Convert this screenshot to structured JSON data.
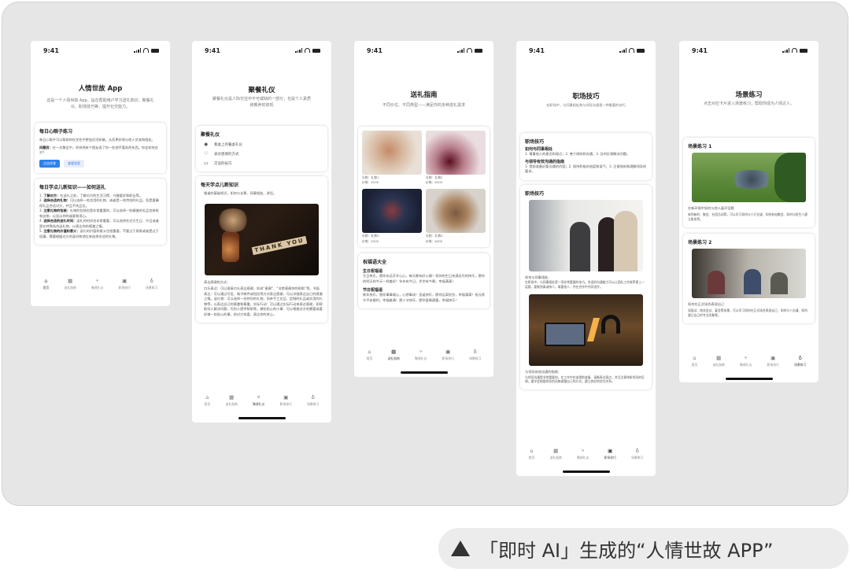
{
  "status_time": "9:41",
  "tabs": [
    {
      "label": "首页",
      "icon": "home-icon",
      "glyph": "⌂"
    },
    {
      "label": "送礼指南",
      "icon": "gift-icon",
      "glyph": "▦"
    },
    {
      "label": "聚餐礼仪",
      "icon": "utensils-icon",
      "glyph": "⑂"
    },
    {
      "label": "职场技巧",
      "icon": "briefcase-icon",
      "glyph": "▣"
    },
    {
      "label": "场景练习",
      "icon": "bulb-icon",
      "glyph": "♁"
    }
  ],
  "screen1": {
    "title": "人情世故 App",
    "subtitle": "这是一个人情世故 App，旨在帮助用户学习送礼知识、聚餐礼仪、职场技巧等，提升社交能力。",
    "card1": {
      "title": "每日心眼子练习",
      "intro": "每日心眼子可以帮助你在交往中更加灵活机敏。从而更好地与他人交流和相处。",
      "question_label": "问题目：",
      "question": "在一次聚会中，你突然有个朋友说了你一些他不喜欢的东西。你会如何应对?",
      "btn_primary": "点击作答",
      "btn_secondary": "查看答案"
    },
    "card2": {
      "title": "每日学点儿新知识——如何送礼",
      "items": [
        {
          "label": "了解对方：",
          "text": "在送礼之前，了解对方的生活习惯、兴趣爱好和职业等。"
        },
        {
          "label": "选择合适的礼物：",
          "text": "可以选择一些实用的礼物、或者是一些特别的礼品，但是要确保礼品合适对方，并且不失品位。"
        },
        {
          "label": "注意礼物的包装：",
          "text": "礼物的包装也是非常重要的，可以选择一些精美的礼品包装纸和丝带，以显示你的诚意和用心。"
        },
        {
          "label": "选择合适的送礼时间：",
          "text": "送礼的时间也非常重要，可以选择在对方生日、节日或者是在特殊场合送礼物，以表达你的感激之情。"
        },
        {
          "label": "注意礼物的价值和意义：",
          "text": "送礼的价值和意义也很重要，不要过于昂贵或者是过于低廉，需要根据对方的身份和地位来选择合适的礼物。"
        }
      ]
    }
  },
  "screen2": {
    "title": "聚餐礼仪",
    "subtitle": "聚餐礼仪是人际交往中不可或缺的一部分，也是个人素质和教养的体现",
    "card1": {
      "title": "聚餐礼仪",
      "rows": [
        {
          "icon": "eye-icon",
          "glyph": "◉",
          "text": "看桌上的餐桌礼仪"
        },
        {
          "icon": "heart-icon",
          "glyph": "♡",
          "text": "表达感谢的方式"
        },
        {
          "icon": "chat-icon",
          "glyph": "▭",
          "text": "交谈的技巧"
        }
      ]
    },
    "card2": {
      "title": "每天学点儿新知识",
      "intro": "餐桌的基础知识，如何与长辈、同事相处、讲话。",
      "image_alt": "THANK YOU",
      "subhead": "表达感谢的方式：",
      "text": "口头表达：可以直接口头表达感谢，如说“谢谢”、“非常感谢你的帮助”等。书面表达：可以通过写信、电子邮件或短信等方式表达感谢，可以详细表达自己的感激之情。送礼物：可以选择一份特别的礼物，如亲手工艺品、定制的礼品或实用的礼物等，以表达自己的感激和尊重。实际行动：可以通过实际行动来表达感谢，如帮助别人解决问题，为别人提供帮助等。做些贴心的小事：可以根据对方的需要或喜好做一些贴心的事，给对方惊喜，表达你的关心。"
    }
  },
  "screen3": {
    "title": "送礼指南",
    "subtitle": "不同价位、不同类型——满足你的多种送礼需求",
    "gifts": [
      {
        "name": "礼物：礼物1",
        "price": "价格：¥100"
      },
      {
        "name": "礼物：礼物2",
        "price": "价格：¥200"
      },
      {
        "name": "礼物：礼物3",
        "price": "价格：¥300"
      },
      {
        "name": "礼物：礼物4",
        "price": "价格：¥400"
      }
    ],
    "card2": {
      "title": "祝福语大全",
      "sections": [
        {
          "title": "生日祝福语",
          "text": "生日快乐，愿你永远开开心心，每天都有好心情！祝你的生日充满无尽的快乐，愿你的明天和今天一样美好！年年有今日，岁岁有今朝，幸福满满！"
        },
        {
          "title": "节日祝福语",
          "text": "新年快乐，愿你事事顺心，心想事成！圣诞快乐，愿你远离忧伤，幸福满满！祝元宵节平安顺利，幸福美满！愿人节快乐，愿你爱情甜蜜，幸福快乐！"
        }
      ]
    }
  },
  "screen4": {
    "title": "职场技巧",
    "subtitle": "在职场中，与同事相处和与领导沟通是一种重要的技巧",
    "card1": {
      "title": "职场技巧",
      "sections": [
        {
          "title": "如何与同事相处",
          "text": "1. 尊重他人的意见和观点；2. 善于倾听和沟通；3. 及时反馈解决问题。"
        },
        {
          "title": "与领导有效沟通的指南",
          "text": "1. 提前准备好要沟通的内容；2. 保持积极的态度和语气；3. 注意倾听和理解领导的要求。"
        }
      ]
    },
    "card2": {
      "title": "职场技巧",
      "cap1": "如何与同事相处：",
      "text1": "在职场中，与同事相处是一项非常重要的技巧。合适的沟通能力可以让团队工作效率更上一层楼，要做到真诚待人，尊重他人，并在合作中共同进步。",
      "cap2": "与领导有效沟通的指南：",
      "text2": "与领导沟通是非常重要的。在工作中应该提前准备、清晰表达观点，并且注意倾听领导的反馈。要学会根据领导的风格调整自己的方式，建立良好的信任关系。"
    }
  },
  "screen5": {
    "title": "场景练习",
    "subtitle": "点击对应卡片进入场景练习，帮助你成为人情达人。",
    "cards": [
      {
        "title": "场景练习 1",
        "text": "在新环境中如何与他人展开话题",
        "detail": "来到新的、聚会、社团活动等，可以学习如何与人打交道、如何参加聚会、如何与陌生人建立联系等。"
      },
      {
        "title": "场景练习 2",
        "text": "如何在正式场合表现自己",
        "detail": "如面试、商务会议、宴会等场景，可以学习如何在正式场合表现自己、如何与人沟通、如何建立自己的专业形象等。"
      }
    ]
  },
  "caption": "「即时 AI」生成的“人情世故 APP”"
}
